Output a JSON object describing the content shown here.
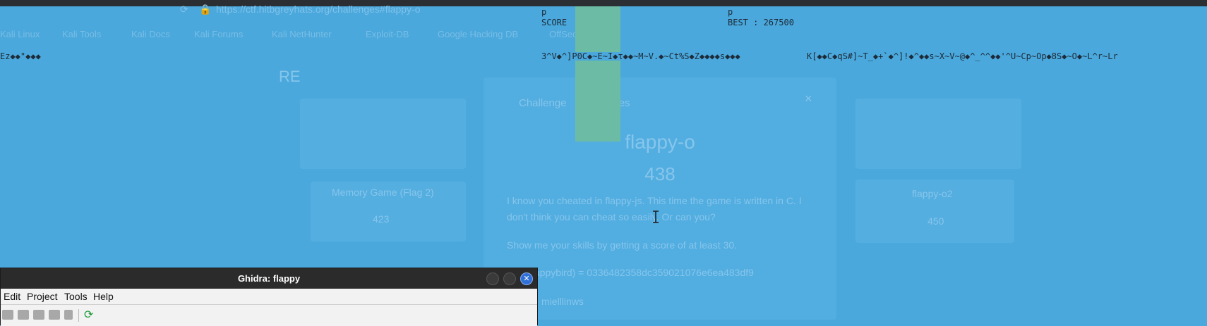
{
  "browser": {
    "url": "https://ctf.hitbgreyhats.org/challenges#flappy-o",
    "bookmarks": [
      "Kali Linux",
      "Kali Tools",
      "Kali Docs",
      "Kali Forums",
      "Kali NetHunter",
      "Exploit-DB",
      "Google Hacking DB",
      "OffSec"
    ]
  },
  "page": {
    "category_title": "RE",
    "challenge_tab": "Challenge",
    "solves_tab": "0 Solves",
    "challenge_name": "flappy-o",
    "challenge_points": "438",
    "description_1": "I know you cheated in flappy-js. This time the game is written in C. I don't think you can cheat so easily. Or can you?",
    "description_2": "Show me your skills by getting a score of at least 30.",
    "hash_line": "md5(flappybird) = 0336482358dc359021076e6ea483df9",
    "author": "Author: mielllinws",
    "left_card_name": "Memory Game (Flag 2)",
    "left_card_points": "423",
    "right_card_name": "flappy-o2",
    "right_card_points": "450"
  },
  "game": {
    "p_left": "p",
    "score_label": "SCORE",
    "p_right": "p",
    "best_label": "BEST : 267500",
    "garbage_left": "Ez◆◆\"◆◆◆",
    "garbage_mid": "3^V◆^]P0C◆~E~I◆τ◆◆~M~V.◆~Ct%S◆Z◆◆◆◆s◆◆◆",
    "garbage_right": "K[◆◆C◆qS#]~T_◆+`◆^]!◆^◆◆s~X~V~@◆^_^^◆◆'^U~Cp~Op◆8S◆~O◆~L^r~Lr"
  },
  "ghidra": {
    "title": "Ghidra: flappy",
    "menu": {
      "edit": "Edit",
      "project": "Project",
      "tools": "Tools",
      "help": "Help"
    }
  },
  "colors": {
    "overlay_blue": "#4aa8dc",
    "pipe_green": "#6cbca5",
    "close_button_blue": "#2f6fd6"
  }
}
